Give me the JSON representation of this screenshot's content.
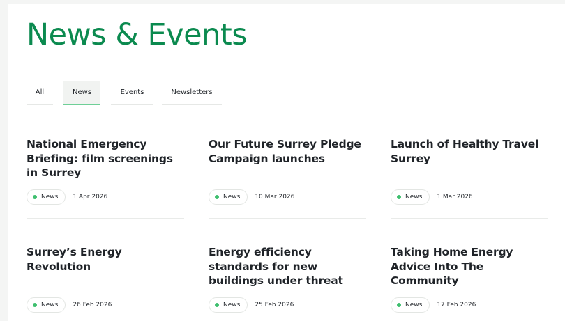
{
  "page": {
    "title": "News & Events"
  },
  "tabs": [
    {
      "label": "All"
    },
    {
      "label": "News",
      "active": true
    },
    {
      "label": "Events"
    },
    {
      "label": "Newsletters"
    }
  ],
  "articles": [
    {
      "title": "National Emergency Briefing: film screenings in Surrey",
      "tag": "News",
      "date": "1 Apr 2026"
    },
    {
      "title": "Our Future Surrey Pledge Campaign launches",
      "tag": "News",
      "date": "10 Mar 2026"
    },
    {
      "title": "Launch of Healthy Travel Surrey",
      "tag": "News",
      "date": "1 Mar 2026"
    },
    {
      "title": "Surrey’s Energy Revolution",
      "tag": "News",
      "date": "26 Feb 2026"
    },
    {
      "title": "Energy efficiency standards for new buildings under threat",
      "tag": "News",
      "date": "25 Feb 2026"
    },
    {
      "title": "Taking Home Energy Advice Into The Community",
      "tag": "News",
      "date": "17 Feb 2026"
    }
  ],
  "colors": {
    "brand_green": "#0b8a4f",
    "badge_dot": "#3fbf6f",
    "active_tab_underline": "#6fcf97"
  }
}
